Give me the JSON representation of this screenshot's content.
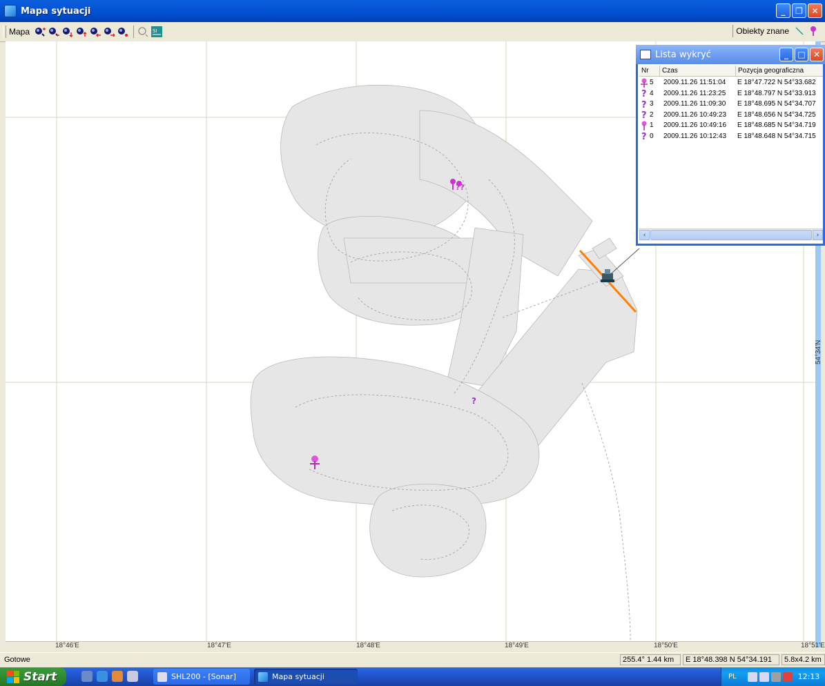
{
  "window": {
    "title": "Mapa sytuacji"
  },
  "toolbar": {
    "mapa_label": "Mapa",
    "objects_label": "Obiekty znane"
  },
  "axis": {
    "x_labels": [
      "18°46'E",
      "18°47'E",
      "18°48'E",
      "18°49'E",
      "18°50'E",
      "18°51'E"
    ],
    "y_labels": [
      "54°34'N"
    ]
  },
  "lista": {
    "title": "Lista wykryć",
    "columns": [
      "Nr",
      "Czas",
      "Pozycja geograficzna"
    ],
    "rows": [
      {
        "nr": "5",
        "czas": "2009.11.26 11:51:04",
        "poz": "E 18°47.722  N 54°33.682",
        "icon": "pin-anchor"
      },
      {
        "nr": "4",
        "czas": "2009.11.26 11:23:25",
        "poz": "E 18°48.797  N 54°33.913",
        "icon": "question"
      },
      {
        "nr": "3",
        "czas": "2009.11.26 11:09:30",
        "poz": "E 18°48.695  N 54°34.707",
        "icon": "question"
      },
      {
        "nr": "2",
        "czas": "2009.11.26 10:49:23",
        "poz": "E 18°48.656  N 54°34.725",
        "icon": "question"
      },
      {
        "nr": "1",
        "czas": "2009.11.26 10:49:16",
        "poz": "E 18°48.685  N 54°34.719",
        "icon": "pin"
      },
      {
        "nr": "0",
        "czas": "2009.11.26 10:12:43",
        "poz": "E 18°48.648  N 54°34.715",
        "icon": "question"
      }
    ]
  },
  "status": {
    "left": "Gotowe",
    "bearing": "255.4° 1.44 km",
    "position": "E 18°48.398  N 54°34.191",
    "extent": "5.8x4.2 km"
  },
  "taskbar": {
    "start": "Start",
    "tasks": [
      "SHL200 - [Sonar]",
      "Mapa sytuacji"
    ],
    "lang": "PL",
    "clock": "12:13"
  },
  "colors": {
    "titlebar": "#0455D6",
    "track": "#ff7f00",
    "marker": "#cc33cc",
    "coverage": "#e6e6e6"
  }
}
